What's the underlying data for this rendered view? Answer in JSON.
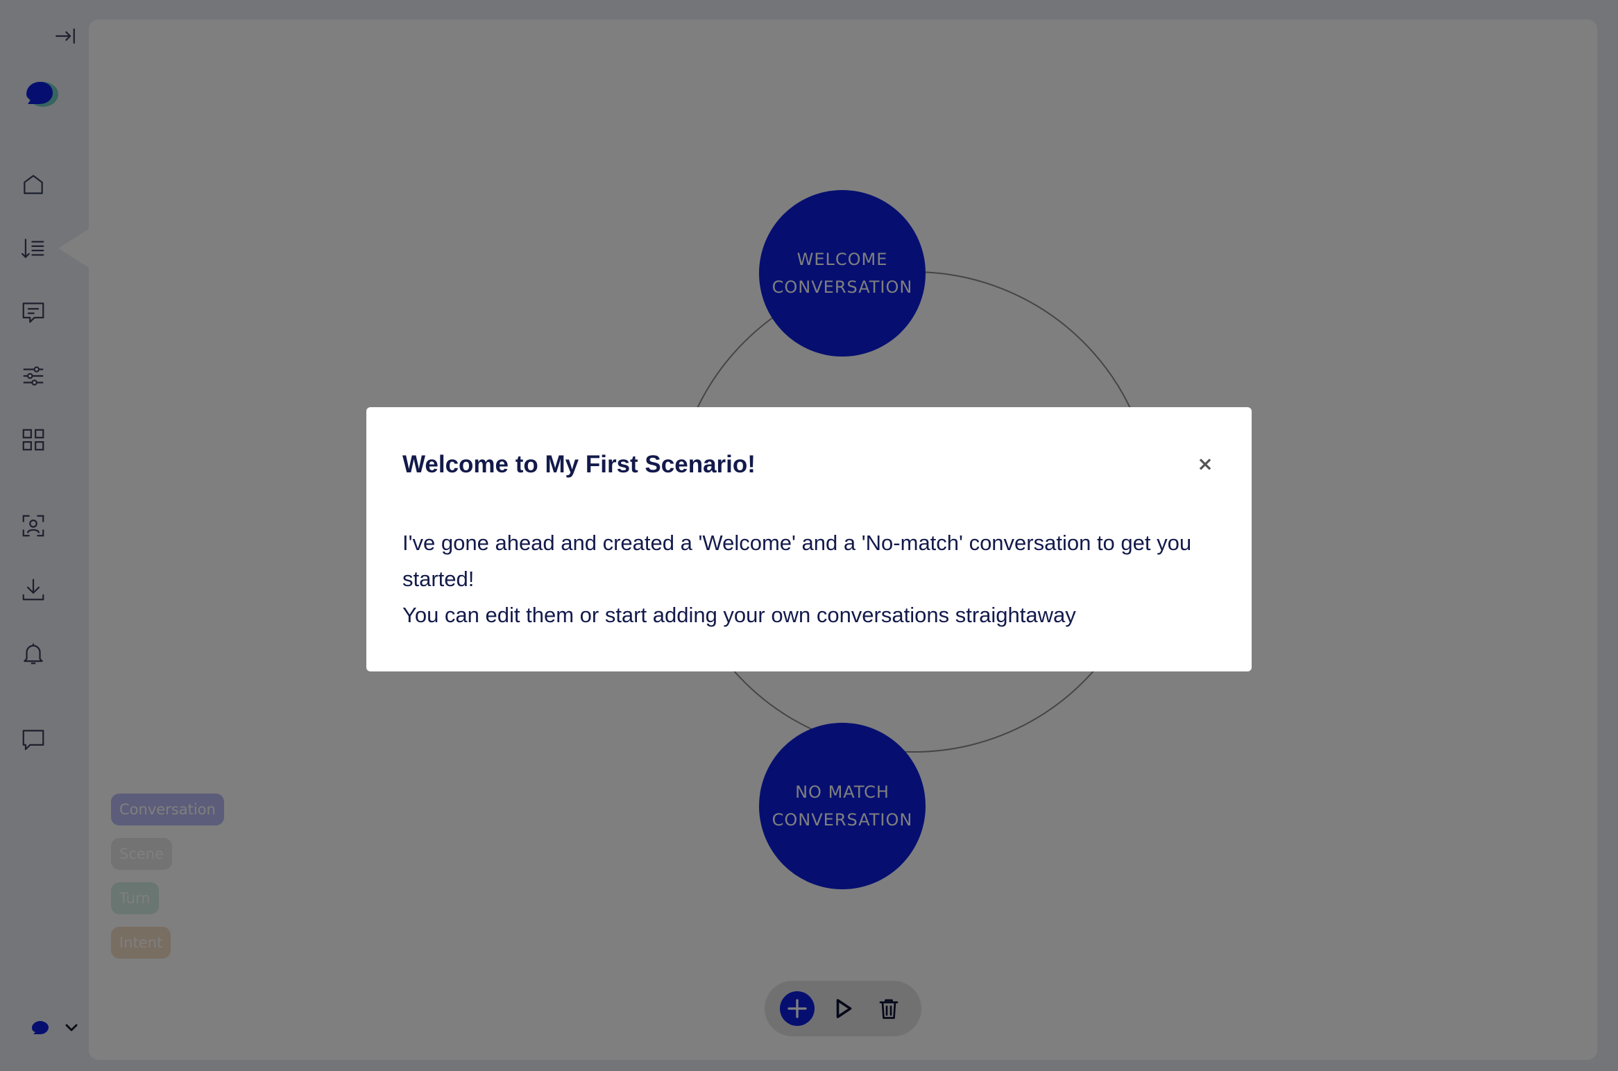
{
  "sidebar": {
    "collapse_icon": "collapse-right-icon",
    "logo_icon": "speech-bubble-logo",
    "items": [
      {
        "name": "home",
        "icon": "home-icon"
      },
      {
        "name": "scenarios",
        "icon": "sort-list-icon",
        "active": true
      },
      {
        "name": "messages",
        "icon": "message-square-icon"
      },
      {
        "name": "settings",
        "icon": "sliders-icon"
      },
      {
        "name": "apps",
        "icon": "grid-icon"
      },
      {
        "name": "scan",
        "icon": "scan-user-icon"
      },
      {
        "name": "download",
        "icon": "download-icon"
      },
      {
        "name": "notifications",
        "icon": "bell-icon"
      },
      {
        "name": "chat",
        "icon": "chat-icon"
      }
    ],
    "user_menu_icon": "chevron-down-icon"
  },
  "canvas": {
    "nodes": [
      {
        "label": "WELCOME CONVERSATION"
      },
      {
        "label": "NO MATCH CONVERSATION"
      }
    ],
    "legend": [
      "Conversation",
      "Scene",
      "Turn",
      "Intent"
    ],
    "toolbar": {
      "add": "plus-icon",
      "play": "play-icon",
      "delete": "trash-icon"
    }
  },
  "modal": {
    "title": "Welcome to My First Scenario!",
    "close_glyph": "×",
    "line1": "I've gone ahead and created a 'Welcome' and a 'No-match' conversation to get you started!",
    "line2": "You can edit them or start adding your own conversations straightaway"
  },
  "colors": {
    "node_blue": "#0d1ee0",
    "text_dark": "#131a4a",
    "overlay": "rgba(0,0,0,0.5)"
  }
}
